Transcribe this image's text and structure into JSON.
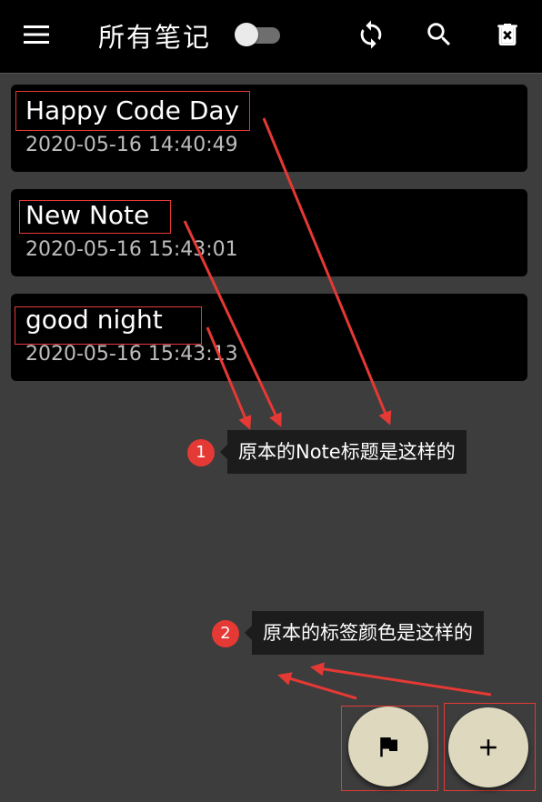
{
  "appbar": {
    "title": "所有笔记",
    "icons": [
      "menu-icon",
      "sync-icon",
      "search-icon",
      "delete-icon"
    ],
    "toggle_on": false
  },
  "notes": [
    {
      "title": "Happy Code Day",
      "date": "2020-05-16 14:40:49"
    },
    {
      "title": "New Note",
      "date": "2020-05-16 15:43:01"
    },
    {
      "title": "good night",
      "date": "2020-05-16 15:43:13"
    }
  ],
  "annotations": [
    {
      "number": "1",
      "text": "原本的Note标题是这样的"
    },
    {
      "number": "2",
      "text": "原本的标签颜色是这样的"
    }
  ],
  "fabs": [
    "flag-icon",
    "add-icon"
  ],
  "colors": {
    "background": "#3d3d3d",
    "card": "#000000",
    "fab": "#ddd8be",
    "annotation_red": "#e53935"
  }
}
